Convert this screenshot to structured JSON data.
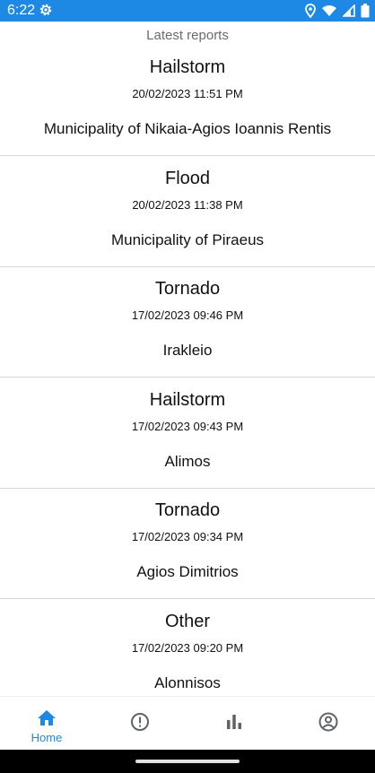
{
  "status_bar": {
    "time": "6:22",
    "icons": [
      "settings-icon",
      "location-icon",
      "wifi-icon",
      "cell-signal-icon",
      "battery-icon"
    ],
    "background": "#1e88e5"
  },
  "header": {
    "title": "Latest reports"
  },
  "reports": [
    {
      "type": "Hailstorm",
      "datetime": "20/02/2023 11:51 PM",
      "location": "Municipality of Nikaia-Agios Ioannis Rentis"
    },
    {
      "type": "Flood",
      "datetime": "20/02/2023 11:38 PM",
      "location": "Municipality of Piraeus"
    },
    {
      "type": "Tornado",
      "datetime": "17/02/2023 09:46 PM",
      "location": "Irakleio"
    },
    {
      "type": "Hailstorm",
      "datetime": "17/02/2023 09:43 PM",
      "location": "Alimos"
    },
    {
      "type": "Tornado",
      "datetime": "17/02/2023 09:34 PM",
      "location": "Agios Dimitrios"
    },
    {
      "type": "Other",
      "datetime": "17/02/2023 09:20 PM",
      "location": "Alonnisos"
    }
  ],
  "bottom_nav": {
    "active_color": "#1e88e5",
    "inactive_color": "#5f6368",
    "items": [
      {
        "icon": "home-icon",
        "label": "Home",
        "active": true
      },
      {
        "icon": "alert-icon",
        "label": "",
        "active": false
      },
      {
        "icon": "stats-icon",
        "label": "",
        "active": false
      },
      {
        "icon": "profile-icon",
        "label": "",
        "active": false
      }
    ]
  }
}
